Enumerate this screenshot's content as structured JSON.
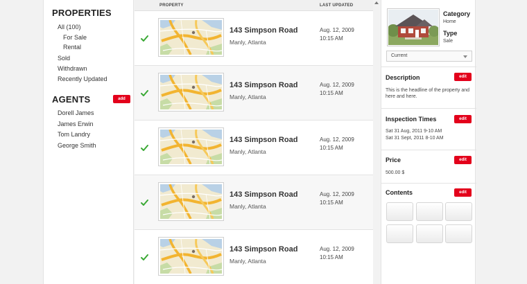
{
  "sidebar": {
    "properties_title": "PROPERTIES",
    "all": "All (100)",
    "for_sale": "For Sale",
    "rental": "Rental",
    "sold": "Sold",
    "withdrawn": "Withdrawn",
    "recently_updated": "Recently Updated",
    "agents_title": "AGENTS",
    "add_label": "add",
    "agents": [
      "Dorell James",
      "James Erwin",
      "Tom Landry",
      "George Smith"
    ]
  },
  "list": {
    "col_property": "PROPERTY",
    "col_updated": "LAST UPDATED",
    "rows": [
      {
        "address": "143 Simpson Road",
        "location": "Manly, Atlanta",
        "date": "Aug. 12, 2009",
        "time": "10:15 AM"
      },
      {
        "address": "143 Simpson Road",
        "location": "Manly, Atlanta",
        "date": "Aug. 12, 2009",
        "time": "10:15 AM"
      },
      {
        "address": "143 Simpson Road",
        "location": "Manly, Atlanta",
        "date": "Aug. 12, 2009",
        "time": "10:15 AM"
      },
      {
        "address": "143 Simpson Road",
        "location": "Manly, Atlanta",
        "date": "Aug. 12, 2009",
        "time": "10:15 AM"
      },
      {
        "address": "143 Simpson Road",
        "location": "Manly, Atlanta",
        "date": "Aug. 12, 2009",
        "time": "10:15 AM"
      }
    ]
  },
  "detail": {
    "category_label": "Category",
    "category_value": "Home",
    "type_label": "Type",
    "type_value": "Sale",
    "status_select": "Current",
    "edit_label": "edit",
    "description_title": "Description",
    "description_text": "This is the headline of the property and here and here.",
    "inspection_title": "Inspection Times",
    "inspection_1": "Sat 31 Aug, 2011 9-10 AM",
    "inspection_2": "Sat 31 Sept, 2011 8-10 AM",
    "price_title": "Price",
    "price_value": "500.00 $",
    "contents_title": "Contents"
  },
  "colors": {
    "accent_red": "#e3001b",
    "check_green": "#3aa935"
  },
  "icons": [
    "check-icon",
    "map-thumbnail",
    "house-photo",
    "chevron-down-icon",
    "scroll-up-arrow"
  ]
}
